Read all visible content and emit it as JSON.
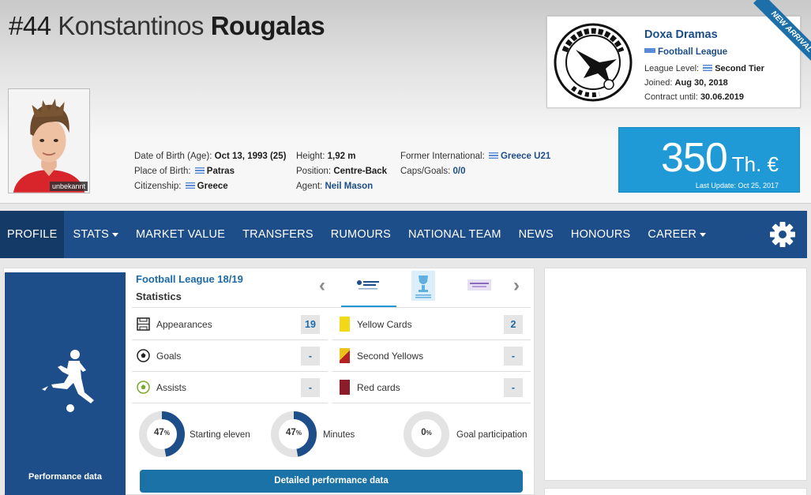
{
  "player": {
    "number": "#44",
    "first_name": "Konstantinos",
    "last_name": "Rougalas",
    "photo_credit": "unbekannt"
  },
  "info": {
    "dob_label": "Date of Birth (Age):",
    "dob_value": "Oct 13, 1993 (25)",
    "pob_label": "Place of Birth:",
    "pob_value": "Patras",
    "citizenship_label": "Citizenship:",
    "citizenship_value": "Greece",
    "height_label": "Height:",
    "height_value": "1,92 m",
    "position_label": "Position:",
    "position_value": "Centre-Back",
    "agent_label": "Agent:",
    "agent_value": "Neil Mason",
    "former_intl_label": "Former International:",
    "former_intl_value": "Greece U21",
    "caps_label": "Caps/Goals:",
    "caps_value": "0/0"
  },
  "club": {
    "name": "Doxa Dramas",
    "league": "Football League",
    "level_label": "League Level:",
    "level_value": "Second Tier",
    "joined_label": "Joined:",
    "joined_value": "Aug 30, 2018",
    "contract_label": "Contract until:",
    "contract_value": "30.06.2019",
    "logo_text": "ΔΟΞΑ ΔΡΑΜΑΣ",
    "logo_year": "1918",
    "ribbon": "NEW ARRIVAL"
  },
  "market_value": {
    "amount": "350",
    "unit": "Th. €",
    "last_update": "Last Update: Oct 25, 2017"
  },
  "nav": {
    "items": [
      {
        "label": "PROFILE"
      },
      {
        "label": "STATS"
      },
      {
        "label": "MARKET VALUE"
      },
      {
        "label": "TRANSFERS"
      },
      {
        "label": "RUMOURS"
      },
      {
        "label": "NATIONAL TEAM"
      },
      {
        "label": "NEWS"
      },
      {
        "label": "HONOURS"
      },
      {
        "label": "CAREER"
      }
    ],
    "gear_icon": "gear-icon"
  },
  "performance": {
    "side_label": "Performance data",
    "season": "Football League 18/19",
    "stats_title": "Statistics",
    "stats": [
      {
        "label": "Appearances",
        "value": "19"
      },
      {
        "label": "Goals",
        "value": "-"
      },
      {
        "label": "Assists",
        "value": "-"
      },
      {
        "label": "Yellow Cards",
        "value": "2"
      },
      {
        "label": "Second Yellows",
        "value": "-"
      },
      {
        "label": "Red cards",
        "value": "-"
      }
    ],
    "donuts": [
      {
        "pct": 47,
        "pct_text": "47",
        "label": "Starting eleven"
      },
      {
        "pct": 47,
        "pct_text": "47",
        "label": "Minutes"
      },
      {
        "pct": 0,
        "pct_text": "0",
        "label": "Goal participation"
      }
    ],
    "pct_sign": "%",
    "detail_button": "Detailed performance data"
  },
  "colors": {
    "nav": "#1d4e89",
    "accent": "#1f9ad6",
    "button": "#1a72a6"
  }
}
